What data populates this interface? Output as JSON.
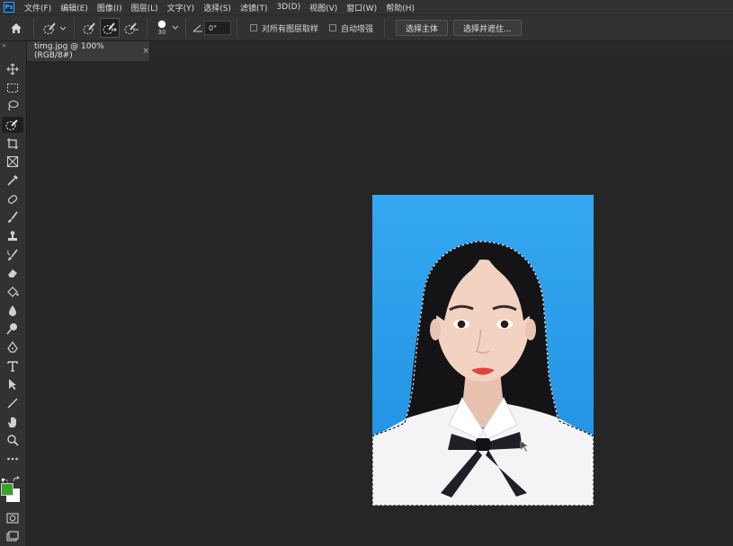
{
  "app": {
    "logo_text": "Ps"
  },
  "menu": [
    "文件(F)",
    "编辑(E)",
    "图像(I)",
    "图层(L)",
    "文字(Y)",
    "选择(S)",
    "滤镜(T)",
    "3D(D)",
    "视图(V)",
    "窗口(W)",
    "帮助(H)"
  ],
  "options": {
    "brush_size": "30",
    "angle_value": "0°",
    "sample_all_layers_label": "对所有图层取样",
    "auto_enhance_label": "自动增强",
    "select_subject_label": "选择主体",
    "select_and_mask_label": "选择并遮住..."
  },
  "document": {
    "tab_title": "timg.jpg @ 100%(RGB/8#)",
    "close_glyph": "×"
  },
  "colors": {
    "foreground": "#3aa02a",
    "background": "#ffffff",
    "photo_bg": "#2aa0ec",
    "accent": "#31a8ff"
  },
  "tools": [
    "move-icon",
    "marquee-icon",
    "lasso-icon",
    "quick-selection-icon",
    "crop-icon",
    "frame-icon",
    "eyedropper-icon",
    "healing-brush-icon",
    "brush-icon",
    "clone-stamp-icon",
    "history-brush-icon",
    "eraser-icon",
    "paint-bucket-icon",
    "blur-icon",
    "dodge-icon",
    "pen-icon",
    "type-icon",
    "path-selection-icon",
    "line-icon",
    "hand-icon",
    "zoom-icon",
    "more-tools-icon"
  ]
}
